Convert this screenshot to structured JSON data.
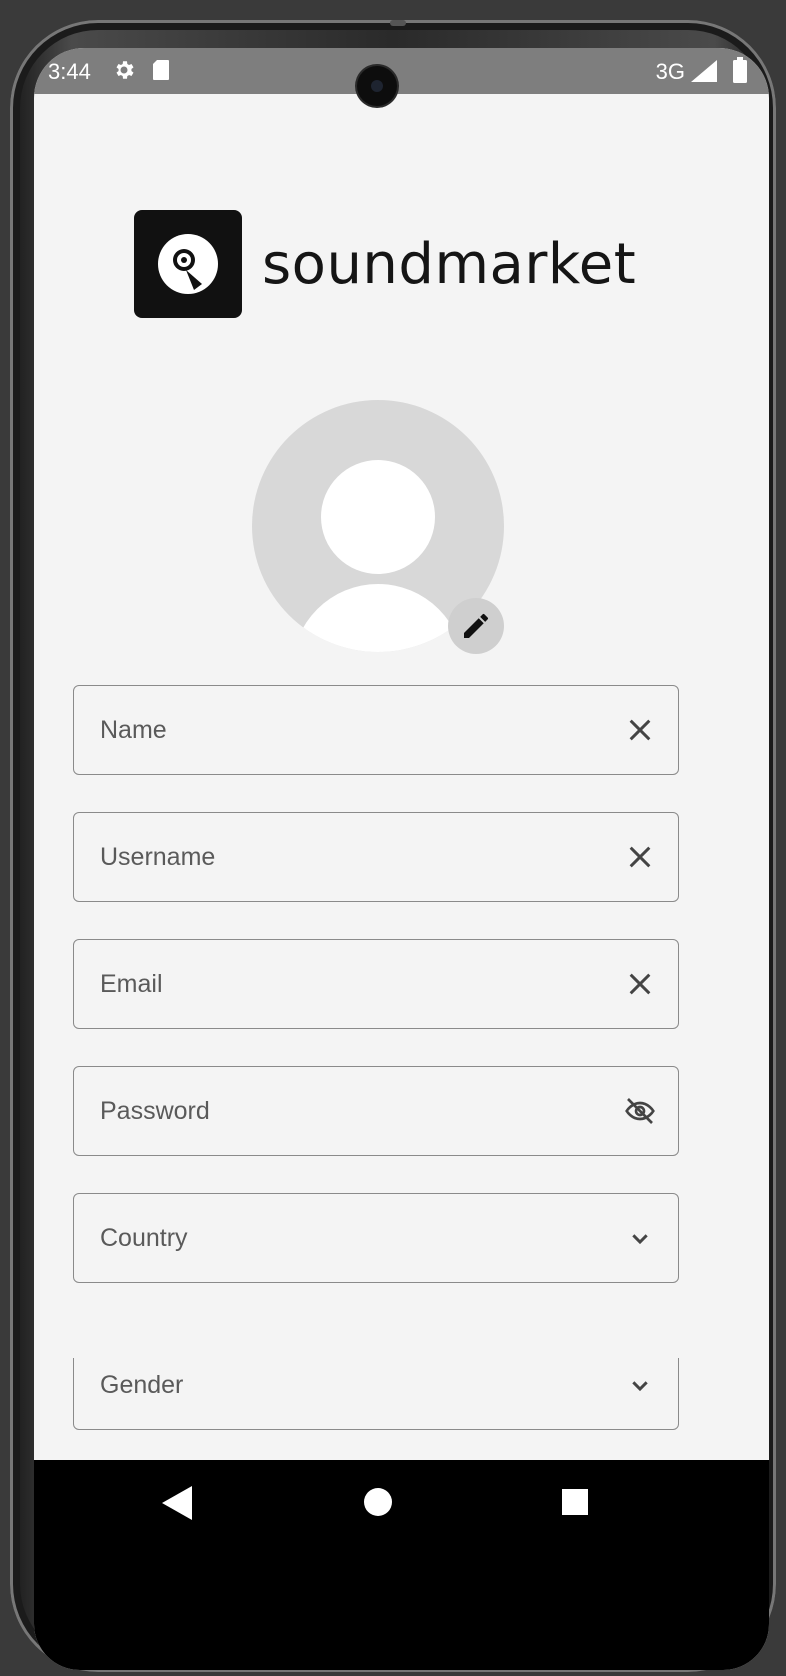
{
  "status_bar": {
    "time": "3:44",
    "network": "3G",
    "icons": [
      "gear-icon",
      "sd-card-icon",
      "signal-icon",
      "battery-icon"
    ]
  },
  "app": {
    "logo_text": "soundmarket"
  },
  "avatar": {
    "edit_icon": "pencil-icon"
  },
  "form": {
    "fields": [
      {
        "label": "Name",
        "trailing_icon": "clear-icon"
      },
      {
        "label": "Username",
        "trailing_icon": "clear-icon"
      },
      {
        "label": "Email",
        "trailing_icon": "clear-icon"
      },
      {
        "label": "Password",
        "trailing_icon": "visibility-off-icon"
      },
      {
        "label": "Country",
        "trailing_icon": "chevron-down-icon"
      },
      {
        "label": "Gender",
        "trailing_icon": "chevron-down-icon"
      }
    ]
  },
  "nav_bar": {
    "icons": [
      "back-icon",
      "home-icon",
      "recents-icon"
    ]
  },
  "colors": {
    "background": "#f4f4f4",
    "status_bar": "#7e7e7e",
    "field_border": "#8a8a8a",
    "text": "#5a5a5a"
  }
}
